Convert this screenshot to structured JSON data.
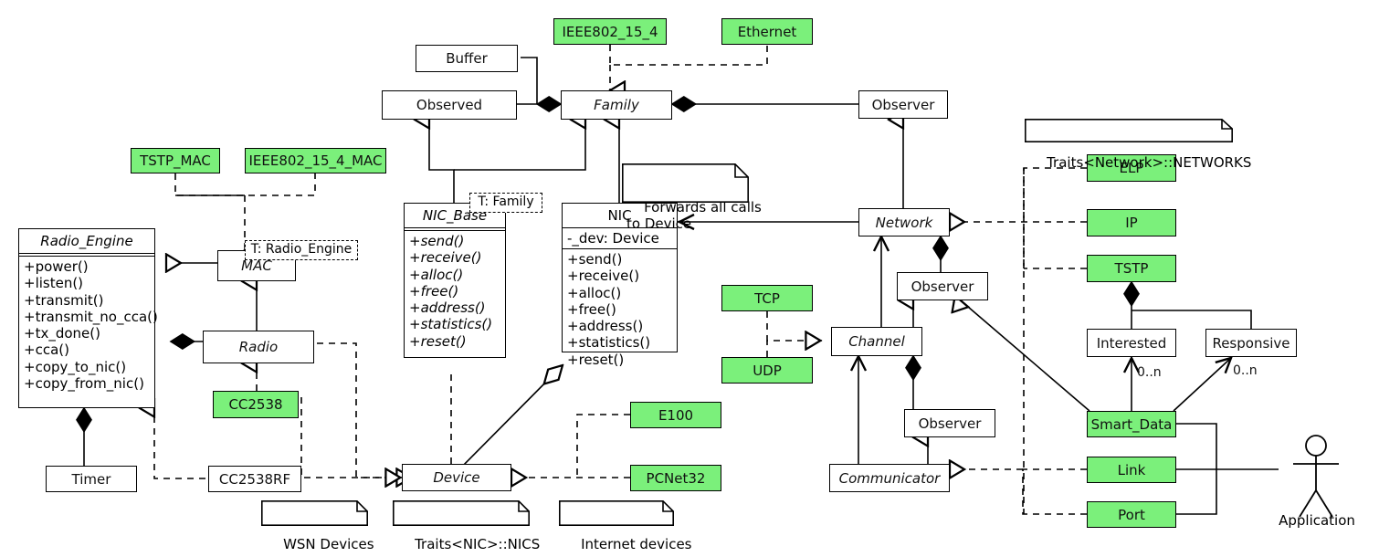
{
  "diagram": {
    "kind": "uml-class-diagram",
    "colors": {
      "highlight_green": "#7BF07B",
      "line": "#000000",
      "background": "#FFFFFF"
    }
  },
  "classes": {
    "radio_engine": {
      "name": "Radio_Engine",
      "ops": [
        "+power()",
        "+listen()",
        "+transmit()",
        "+transmit_no_cca()",
        "+tx_done()",
        "+cca()",
        "+copy_to_nic()",
        "+copy_from_nic()"
      ]
    },
    "mac": {
      "name": "MAC",
      "template": "T: Radio_Engine"
    },
    "radio": {
      "name": "Radio"
    },
    "timer": {
      "name": "Timer"
    },
    "cc2538rf": {
      "name": "CC2538RF"
    },
    "nic_base": {
      "name": "NIC_Base",
      "template": "T: Family",
      "ops": [
        "+send()",
        "+receive()",
        "+alloc()",
        "+free()",
        "+address()",
        "+statistics()",
        "+reset()"
      ]
    },
    "nic": {
      "name": "NIC",
      "attrs": [
        "-_dev: Device"
      ],
      "ops": [
        "+send()",
        "+receive()",
        "+alloc()",
        "+free()",
        "+address()",
        "+statistics()",
        "+reset()"
      ]
    },
    "buffer": {
      "name": "Buffer"
    },
    "observed": {
      "name": "Observed"
    },
    "family": {
      "name": "Family"
    },
    "observer_top": {
      "name": "Observer"
    },
    "network": {
      "name": "Network"
    },
    "observer_net": {
      "name": "Observer"
    },
    "channel": {
      "name": "Channel"
    },
    "observer_chan": {
      "name": "Observer"
    },
    "communicator": {
      "name": "Communicator"
    },
    "device": {
      "name": "Device"
    },
    "interested": {
      "name": "Interested"
    },
    "responsive": {
      "name": "Responsive"
    }
  },
  "green_boxes": {
    "tstp_mac": "TSTP_MAC",
    "ieee802_15_4_mac": "IEEE802_15_4_MAC",
    "cc2538": "CC2538",
    "ieee802_15_4": "IEEE802_15_4",
    "ethernet": "Ethernet",
    "tcp": "TCP",
    "udp": "UDP",
    "e100": "E100",
    "pcnet32": "PCNet32",
    "elp": "ELP",
    "ip": "IP",
    "tstp": "TSTP",
    "smart_data": "Smart_Data",
    "link": "Link",
    "port": "Port"
  },
  "notes": {
    "traits_networks": "Traits<Network>::NETWORKS",
    "forwards": "Forwards all calls\nto Device",
    "wsn_devices": "WSN Devices",
    "traits_nics": "Traits<NIC>::NICS",
    "internet_devices": "Internet devices"
  },
  "actor": {
    "label": "Application"
  },
  "multiplicities": {
    "interested": "0..n",
    "responsive": "0..n"
  }
}
